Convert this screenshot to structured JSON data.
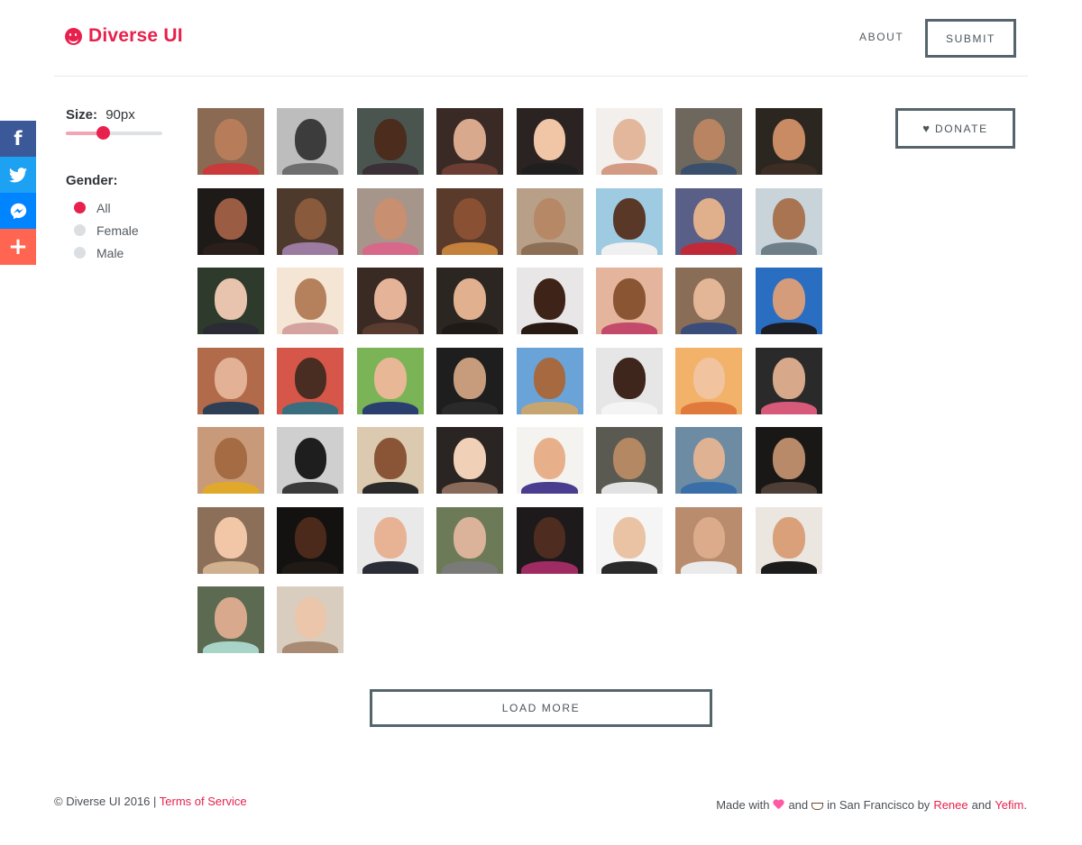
{
  "header": {
    "logo_text": "Diverse UI",
    "nav_about": "ABOUT",
    "nav_submit": "SUBMIT"
  },
  "share": {
    "facebook_icon": "f",
    "more_icon": "+"
  },
  "filters": {
    "size_label": "Size:",
    "size_value": "90px",
    "size_level": 0.38,
    "gender_label": "Gender:",
    "gender_options": [
      {
        "label": "All",
        "selected": true
      },
      {
        "label": "Female",
        "selected": false
      },
      {
        "label": "Male",
        "selected": false
      }
    ]
  },
  "donate": {
    "icon": "heart-icon",
    "label": "DONATE"
  },
  "load_more_label": "LOAD MORE",
  "footer": {
    "copyright": "© Diverse UI 2016 |",
    "terms_link": "Terms of Service",
    "made_with": "Made with",
    "and1": "and",
    "in_city": "in San Francisco by",
    "author1": "Renee",
    "and2": "and",
    "author2": "Yefim",
    "period": "."
  },
  "colors": {
    "accent": "#e8204d",
    "border": "#56656c",
    "facebook": "#3b5998",
    "twitter": "#1da1f2",
    "messenger": "#0084ff",
    "more": "#ff6550"
  },
  "avatars": [
    {
      "bg": "#8a6a52",
      "skin": "#b77d5b",
      "body": "#c93a3a"
    },
    {
      "bg": "#bdbdbd",
      "skin": "#3c3c3c",
      "body": "#6e6e6e"
    },
    {
      "bg": "#4a5550",
      "skin": "#4b2c1d",
      "body": "#3a3036"
    },
    {
      "bg": "#3a2a26",
      "skin": "#d9a98e",
      "body": "#6b3d33"
    },
    {
      "bg": "#2a2322",
      "skin": "#f0c6a6",
      "body": "#1f1f1f"
    },
    {
      "bg": "#f2efec",
      "skin": "#e2b79b",
      "body": "#d49b84"
    },
    {
      "bg": "#6e675e",
      "skin": "#b98462",
      "body": "#3a4f6b"
    },
    {
      "bg": "#2b2620",
      "skin": "#c98b63",
      "body": "#3c2e25"
    },
    {
      "bg": "#1e1a18",
      "skin": "#9a5d43",
      "body": "#2a1f1b"
    },
    {
      "bg": "#4d3a2d",
      "skin": "#8a5a3c",
      "body": "#9b7ba0"
    },
    {
      "bg": "#a6958a",
      "skin": "#c88f70",
      "body": "#d8688a"
    },
    {
      "bg": "#5a3b2b",
      "skin": "#8a5034",
      "body": "#c4813c"
    },
    {
      "bg": "#b8a088",
      "skin": "#b68866",
      "body": "#8c6f55"
    },
    {
      "bg": "#9fcbe2",
      "skin": "#5a3828",
      "body": "#f0f0f0"
    },
    {
      "bg": "#5a5f88",
      "skin": "#e0b08c",
      "body": "#c02a38"
    },
    {
      "bg": "#c8d4da",
      "skin": "#a87452",
      "body": "#6f7f8a"
    },
    {
      "bg": "#2e3a2c",
      "skin": "#e8c4ae",
      "body": "#2b2b35"
    },
    {
      "bg": "#f4e5d5",
      "skin": "#b5805c",
      "body": "#d4a3a0"
    },
    {
      "bg": "#3a2a24",
      "skin": "#e5b498",
      "body": "#5a3b30"
    },
    {
      "bg": "#2c2622",
      "skin": "#e1b08e",
      "body": "#201a17"
    },
    {
      "bg": "#e8e6e6",
      "skin": "#3e2318",
      "body": "#2a1a14"
    },
    {
      "bg": "#e4b49c",
      "skin": "#8a5532",
      "body": "#c34a6a"
    },
    {
      "bg": "#8a6d56",
      "skin": "#e2b696",
      "body": "#3a4d7a"
    },
    {
      "bg": "#2a6ec2",
      "skin": "#d49c7a",
      "body": "#1d1d24"
    },
    {
      "bg": "#b16a4a",
      "skin": "#e3b195",
      "body": "#2e3f55"
    },
    {
      "bg": "#d6574a",
      "skin": "#4a2d22",
      "body": "#3a6e7e"
    },
    {
      "bg": "#7bb456",
      "skin": "#e8b796",
      "body": "#2a3f6e"
    },
    {
      "bg": "#1e1e1e",
      "skin": "#c79c7c",
      "body": "#2a2a2a"
    },
    {
      "bg": "#6aa3d8",
      "skin": "#a7693f",
      "body": "#c7a571"
    },
    {
      "bg": "#e6e6e6",
      "skin": "#3e261c",
      "body": "#f4f4f4"
    },
    {
      "bg": "#f2b26a",
      "skin": "#f1c39e",
      "body": "#e07a3c"
    },
    {
      "bg": "#2a2a2a",
      "skin": "#d8a88a",
      "body": "#d85a7a"
    },
    {
      "bg": "#c99a7a",
      "skin": "#a56c43",
      "body": "#e0a92c"
    },
    {
      "bg": "#cfcfcf",
      "skin": "#1e1e1e",
      "body": "#3a3a3a"
    },
    {
      "bg": "#dccab0",
      "skin": "#8a5436",
      "body": "#2a2a2a"
    },
    {
      "bg": "#2a2522",
      "skin": "#f1d0b8",
      "body": "#8a6a5a"
    },
    {
      "bg": "#f5f3ef",
      "skin": "#e8b08a",
      "body": "#4a3c8e"
    },
    {
      "bg": "#5a5a52",
      "skin": "#b38862",
      "body": "#e2e2e2"
    },
    {
      "bg": "#6d8ca4",
      "skin": "#e0b294",
      "body": "#3a6ea8"
    },
    {
      "bg": "#1a1816",
      "skin": "#b88a6a",
      "body": "#4e3f36"
    },
    {
      "bg": "#8b6f58",
      "skin": "#f1c7a8",
      "body": "#d0b08e"
    },
    {
      "bg": "#141210",
      "skin": "#4b2a1b",
      "body": "#201a16"
    },
    {
      "bg": "#e9e9e9",
      "skin": "#e8b394",
      "body": "#2a2d35"
    },
    {
      "bg": "#6d7a58",
      "skin": "#dab39a",
      "body": "#7a7a78"
    },
    {
      "bg": "#1e1a1c",
      "skin": "#4e2c1f",
      "body": "#9e2b62"
    },
    {
      "bg": "#f5f5f5",
      "skin": "#eac3a4",
      "body": "#2a2a2a"
    },
    {
      "bg": "#ba8c6e",
      "skin": "#dcab8c",
      "body": "#eaeaea"
    },
    {
      "bg": "#ebe6e0",
      "skin": "#d9a07a",
      "body": "#1c1c1c"
    },
    {
      "bg": "#5c6a52",
      "skin": "#d8a98c",
      "body": "#a8d4c8"
    },
    {
      "bg": "#d8cdbf",
      "skin": "#ecc6aa",
      "body": "#a88b72"
    }
  ]
}
